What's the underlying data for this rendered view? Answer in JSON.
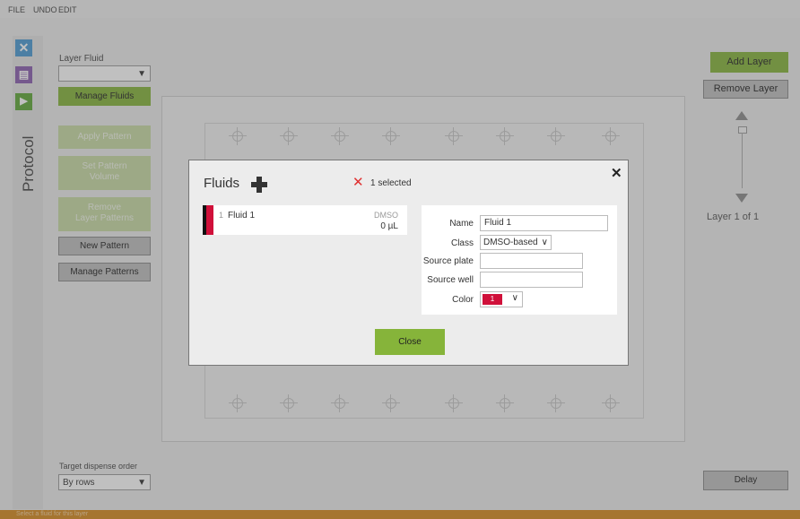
{
  "menu": {
    "file": "FILE",
    "undo": "UNDO",
    "edit": "EDIT"
  },
  "sidebar": {
    "icons": [
      {
        "name": "close-icon",
        "glyph": "✕",
        "color": "#4a9ad4"
      },
      {
        "name": "save-icon",
        "glyph": "▤",
        "color": "#8a5fb0"
      },
      {
        "name": "play-icon",
        "glyph": "▶",
        "color": "#5fa838"
      }
    ],
    "title": "Protocol"
  },
  "left_panel": {
    "layer_fluid_label": "Layer Fluid",
    "layer_fluid_value": "",
    "manage_fluids": "Manage Fluids",
    "apply_pattern": "Apply Pattern",
    "set_pattern_volume": [
      "Set Pattern",
      "Volume"
    ],
    "remove_layer_patterns": [
      "Remove",
      "Layer Patterns"
    ],
    "new_pattern": "New Pattern",
    "manage_patterns": "Manage Patterns",
    "dispense_order_label": "Target dispense order",
    "dispense_order_value": "By rows"
  },
  "right_panel": {
    "add_layer": "Add Layer",
    "remove_layer": "Remove Layer",
    "layer_indicator": "Layer 1 of 1",
    "delay": "Delay"
  },
  "dialog": {
    "title": "Fluids",
    "selected_text": "1 selected",
    "fluids": [
      {
        "index": "1",
        "name": "Fluid 1",
        "class": "DMSO",
        "volume": "0 µL",
        "color": "#d0103a"
      }
    ],
    "form": {
      "name_label": "Name",
      "name_value": "Fluid 1",
      "class_label": "Class",
      "class_value": "DMSO-based",
      "source_plate_label": "Source plate",
      "source_plate_value": "",
      "source_well_label": "Source well",
      "source_well_value": "",
      "color_label": "Color",
      "color_value": "1",
      "color_hex": "#d0103a"
    },
    "close_button": "Close"
  },
  "status": {
    "text": "Select a fluid for this layer"
  },
  "colors": {
    "accent_green": "#86b43a",
    "status_orange": "#d68a1e",
    "fluid_red": "#d0103a"
  }
}
